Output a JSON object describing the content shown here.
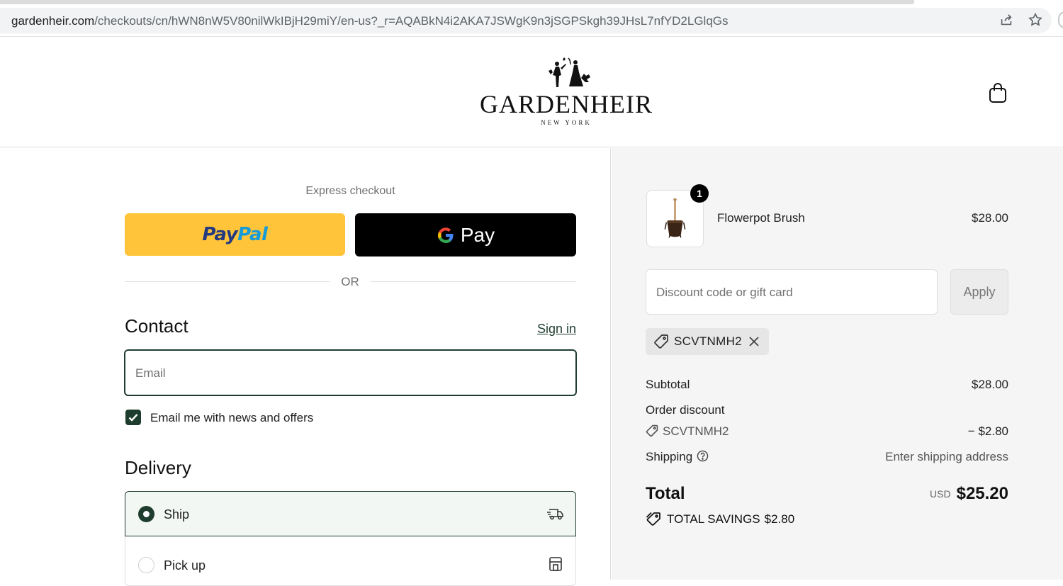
{
  "browser": {
    "url_host": "gardenheir.com",
    "url_path": "/checkouts/cn/hWN8nW5V80nilWkIBjH29miY/en-us?_r=AQABkN4i2AKA7JSWgK9n3jSGPSkgh39JHsL7nfYD2LGlqGs"
  },
  "header": {
    "logo_word": "GARDENHEIR",
    "logo_sub": "NEW YORK"
  },
  "checkout": {
    "express_label": "Express checkout",
    "paypal_pay": "Pay",
    "paypal_pal": "Pal",
    "gpay_label": "Pay",
    "or_label": "OR",
    "contact_title": "Contact",
    "sign_in": "Sign in",
    "email_placeholder": "Email",
    "news_label": "Email me with news and offers",
    "news_checked": true,
    "delivery_title": "Delivery",
    "ship_label": "Ship",
    "pickup_label": "Pick up",
    "selected_delivery": "Ship"
  },
  "summary": {
    "product_name": "Flowerpot Brush",
    "product_qty": "1",
    "product_price": "$28.00",
    "discount_placeholder": "Discount code or gift card",
    "apply_label": "Apply",
    "applied_code": "SCVTNMH2",
    "subtotal_label": "Subtotal",
    "subtotal_value": "$28.00",
    "order_discount_label": "Order discount",
    "discount_code": "SCVTNMH2",
    "discount_amount": "− $2.80",
    "shipping_label": "Shipping",
    "shipping_value": "Enter shipping address",
    "total_label": "Total",
    "total_currency": "USD",
    "total_amount": "$25.20",
    "savings_label": "TOTAL SAVINGS",
    "savings_amount": "$2.80"
  },
  "colors": {
    "accent": "#1f3d2f",
    "paypal_yellow": "#ffc439",
    "gpay_black": "#000000",
    "summary_bg": "#f5f5f5"
  },
  "icons": [
    "share-icon",
    "star-icon",
    "cart-icon",
    "google-g-icon",
    "check-icon",
    "truck-icon",
    "store-icon",
    "tag-icon",
    "close-icon",
    "help-icon",
    "savings-tag-icon"
  ]
}
